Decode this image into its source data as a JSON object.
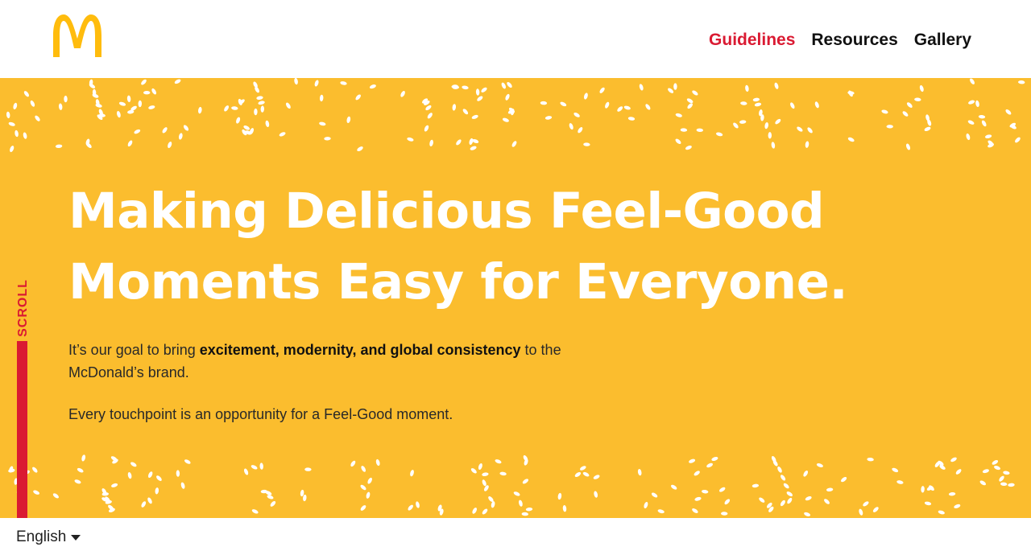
{
  "brand": {
    "logo_icon": "golden-arches-icon",
    "accent_yellow": "#FBBD2E",
    "logo_yellow": "#FFBC0D",
    "accent_red": "#DA1A32"
  },
  "nav": {
    "items": [
      {
        "label": "Guidelines",
        "active": true
      },
      {
        "label": "Resources",
        "active": false
      },
      {
        "label": "Gallery",
        "active": false
      }
    ]
  },
  "hero": {
    "headline_line1": "Making Delicious  Feel-Good",
    "headline_line2": "Moments Easy for Everyone.",
    "intro_before": "It’s our goal to bring ",
    "intro_bold": "excitement, modernity, and global consistency",
    "intro_after": " to the McDonald’s brand.",
    "tagline": "Every touchpoint is an opportunity for a Feel-Good moment."
  },
  "scroll": {
    "label": "SCROLL"
  },
  "footer": {
    "language": "English",
    "language_icon": "caret-down-icon"
  }
}
